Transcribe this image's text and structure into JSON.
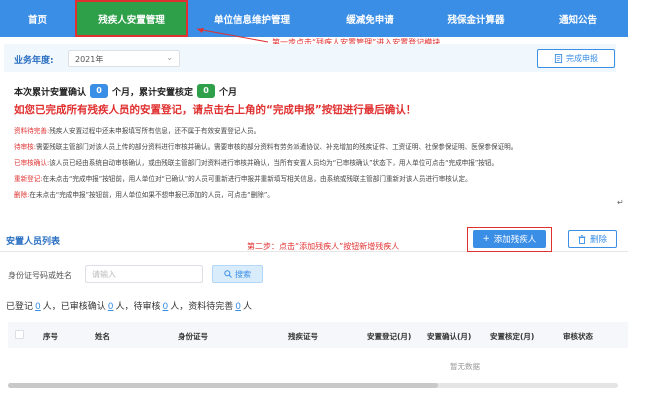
{
  "nav": {
    "items": [
      {
        "label": "首页",
        "active": false
      },
      {
        "label": "残疾人安置管理",
        "active": true
      },
      {
        "label": "单位信息维护管理",
        "active": false
      },
      {
        "label": "缓减免申请",
        "active": false
      },
      {
        "label": "残保金计算器",
        "active": false
      },
      {
        "label": "通知公告",
        "active": false
      }
    ]
  },
  "callouts": {
    "step1": "第一步点击“残疾人安置管理”进入安置登记模块",
    "step2": "第二步：点击“添加残疾人”按钮新增残疾人"
  },
  "filter": {
    "year_label": "业务年度:",
    "year_value": "2021年",
    "complete_button": "完成申报"
  },
  "summary": {
    "prefix": "本次累计安置确认",
    "confirmed_count": "0",
    "middle": "个月，累计安置核定",
    "approved_count": "0",
    "suffix": "个月"
  },
  "warning": "如您已完成所有残疾人员的安置登记，请点击右上角的“完成申报”按钮进行最后确认！",
  "notes": [
    {
      "tag": "资料待完善:",
      "text": "残疾人安置过程中还未申报填写所有信息，还不属于有效安置登记人员。"
    },
    {
      "tag": "待审核:",
      "text": "需要残联主管部门对该人员上传的部分资料进行审核并确认。需要审核的部分资料有劳务派遣协议、补充增加的残疾证件、工资证明、社保参保证明、医保参保证明。"
    },
    {
      "tag": "已审核确认:",
      "text": "该人员已经由系统自动审核确认，或由残联主管部门对资料进行审核并确认，当所有安置人员均为“已审核确认”状态下，用人单位可点击“完成申报”按钮。"
    },
    {
      "tag": "重新登记:",
      "text": "在未点击“完成申报”按钮前，用人单位对“已确认”的人员可重新进行申报并重新填写相关信息，由系统或残联主管部门重新对该人员进行审核认定。"
    },
    {
      "tag": "删除:",
      "text": "在未点击“完成申报”按钮前，用人单位如果不想申报已添加的人员，可点击“删除”。"
    }
  ],
  "list": {
    "title": "安置人员列表",
    "add_button": "添加残疾人",
    "delete_button": "删除"
  },
  "search": {
    "label": "身份证号码或姓名",
    "placeholder": "请输入",
    "button": "搜索"
  },
  "stats": {
    "registered_label": "已登记",
    "registered": "0",
    "approved_label": "人，已审核确认",
    "approved": "0",
    "pending_label": "人，待审核",
    "pending": "0",
    "incomplete_label": "人，资料待完善",
    "incomplete": "0",
    "end": "人"
  },
  "table": {
    "columns": [
      "序号",
      "姓名",
      "身份证号",
      "残疾证号",
      "安置登记(月)",
      "安置确认(月)",
      "安置核定(月)",
      "审核状态"
    ],
    "empty_text": "暂无数据"
  },
  "colors": {
    "primary": "#3a8ee6",
    "active_nav": "#2fa04a",
    "annotation_red": "#e03030"
  }
}
